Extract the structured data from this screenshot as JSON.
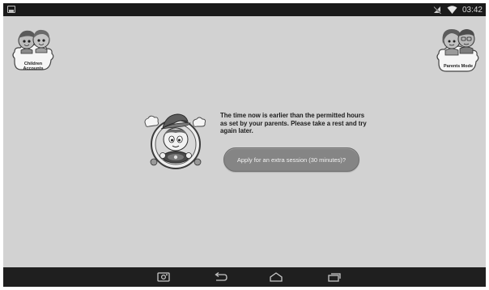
{
  "status_bar": {
    "time": "03:42",
    "icons": [
      "image-notification-icon",
      "signal-muted-icon",
      "wifi-icon"
    ]
  },
  "header": {
    "children_accounts_label_line1": "Children",
    "children_accounts_label_line2": "Accounts",
    "parents_mode_label": "Parents Mode"
  },
  "main": {
    "message": "The time now is earlier than the permitted hours as set by your parents. Please take a rest and try again later.",
    "extra_session_button_label": "Apply for an extra session (30 minutes)?"
  },
  "nav_bar": {
    "icons": [
      "screenshot-icon",
      "back-icon",
      "home-icon",
      "recent-apps-icon"
    ]
  },
  "colors": {
    "background": "#d2d2d2",
    "system_bar": "#1a1a1a",
    "button": "#858585",
    "button_text": "#f2f2f2"
  }
}
